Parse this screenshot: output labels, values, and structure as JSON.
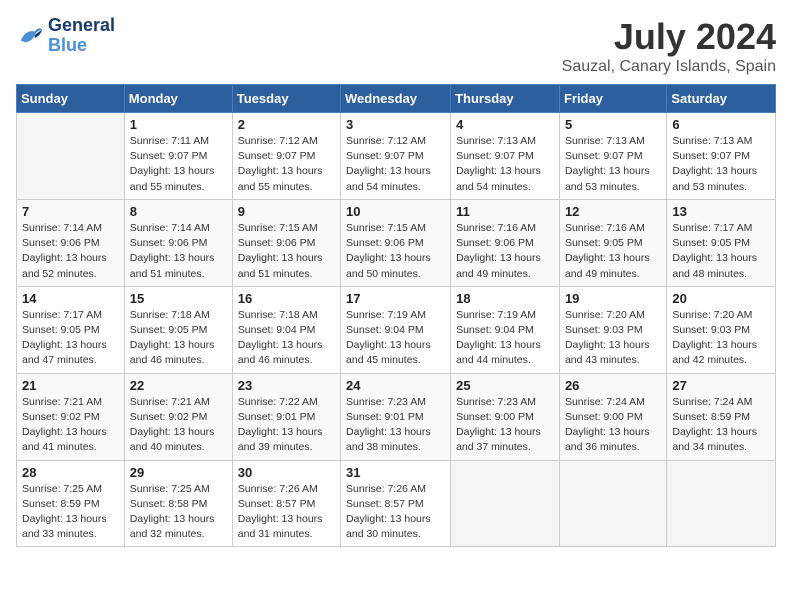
{
  "header": {
    "logo_line1": "General",
    "logo_line2": "Blue",
    "month_year": "July 2024",
    "location": "Sauzal, Canary Islands, Spain"
  },
  "columns": [
    "Sunday",
    "Monday",
    "Tuesday",
    "Wednesday",
    "Thursday",
    "Friday",
    "Saturday"
  ],
  "weeks": [
    [
      {
        "day": "",
        "info": ""
      },
      {
        "day": "1",
        "info": "Sunrise: 7:11 AM\nSunset: 9:07 PM\nDaylight: 13 hours\nand 55 minutes."
      },
      {
        "day": "2",
        "info": "Sunrise: 7:12 AM\nSunset: 9:07 PM\nDaylight: 13 hours\nand 55 minutes."
      },
      {
        "day": "3",
        "info": "Sunrise: 7:12 AM\nSunset: 9:07 PM\nDaylight: 13 hours\nand 54 minutes."
      },
      {
        "day": "4",
        "info": "Sunrise: 7:13 AM\nSunset: 9:07 PM\nDaylight: 13 hours\nand 54 minutes."
      },
      {
        "day": "5",
        "info": "Sunrise: 7:13 AM\nSunset: 9:07 PM\nDaylight: 13 hours\nand 53 minutes."
      },
      {
        "day": "6",
        "info": "Sunrise: 7:13 AM\nSunset: 9:07 PM\nDaylight: 13 hours\nand 53 minutes."
      }
    ],
    [
      {
        "day": "7",
        "info": "Sunrise: 7:14 AM\nSunset: 9:06 PM\nDaylight: 13 hours\nand 52 minutes."
      },
      {
        "day": "8",
        "info": "Sunrise: 7:14 AM\nSunset: 9:06 PM\nDaylight: 13 hours\nand 51 minutes."
      },
      {
        "day": "9",
        "info": "Sunrise: 7:15 AM\nSunset: 9:06 PM\nDaylight: 13 hours\nand 51 minutes."
      },
      {
        "day": "10",
        "info": "Sunrise: 7:15 AM\nSunset: 9:06 PM\nDaylight: 13 hours\nand 50 minutes."
      },
      {
        "day": "11",
        "info": "Sunrise: 7:16 AM\nSunset: 9:06 PM\nDaylight: 13 hours\nand 49 minutes."
      },
      {
        "day": "12",
        "info": "Sunrise: 7:16 AM\nSunset: 9:05 PM\nDaylight: 13 hours\nand 49 minutes."
      },
      {
        "day": "13",
        "info": "Sunrise: 7:17 AM\nSunset: 9:05 PM\nDaylight: 13 hours\nand 48 minutes."
      }
    ],
    [
      {
        "day": "14",
        "info": "Sunrise: 7:17 AM\nSunset: 9:05 PM\nDaylight: 13 hours\nand 47 minutes."
      },
      {
        "day": "15",
        "info": "Sunrise: 7:18 AM\nSunset: 9:05 PM\nDaylight: 13 hours\nand 46 minutes."
      },
      {
        "day": "16",
        "info": "Sunrise: 7:18 AM\nSunset: 9:04 PM\nDaylight: 13 hours\nand 46 minutes."
      },
      {
        "day": "17",
        "info": "Sunrise: 7:19 AM\nSunset: 9:04 PM\nDaylight: 13 hours\nand 45 minutes."
      },
      {
        "day": "18",
        "info": "Sunrise: 7:19 AM\nSunset: 9:04 PM\nDaylight: 13 hours\nand 44 minutes."
      },
      {
        "day": "19",
        "info": "Sunrise: 7:20 AM\nSunset: 9:03 PM\nDaylight: 13 hours\nand 43 minutes."
      },
      {
        "day": "20",
        "info": "Sunrise: 7:20 AM\nSunset: 9:03 PM\nDaylight: 13 hours\nand 42 minutes."
      }
    ],
    [
      {
        "day": "21",
        "info": "Sunrise: 7:21 AM\nSunset: 9:02 PM\nDaylight: 13 hours\nand 41 minutes."
      },
      {
        "day": "22",
        "info": "Sunrise: 7:21 AM\nSunset: 9:02 PM\nDaylight: 13 hours\nand 40 minutes."
      },
      {
        "day": "23",
        "info": "Sunrise: 7:22 AM\nSunset: 9:01 PM\nDaylight: 13 hours\nand 39 minutes."
      },
      {
        "day": "24",
        "info": "Sunrise: 7:23 AM\nSunset: 9:01 PM\nDaylight: 13 hours\nand 38 minutes."
      },
      {
        "day": "25",
        "info": "Sunrise: 7:23 AM\nSunset: 9:00 PM\nDaylight: 13 hours\nand 37 minutes."
      },
      {
        "day": "26",
        "info": "Sunrise: 7:24 AM\nSunset: 9:00 PM\nDaylight: 13 hours\nand 36 minutes."
      },
      {
        "day": "27",
        "info": "Sunrise: 7:24 AM\nSunset: 8:59 PM\nDaylight: 13 hours\nand 34 minutes."
      }
    ],
    [
      {
        "day": "28",
        "info": "Sunrise: 7:25 AM\nSunset: 8:59 PM\nDaylight: 13 hours\nand 33 minutes."
      },
      {
        "day": "29",
        "info": "Sunrise: 7:25 AM\nSunset: 8:58 PM\nDaylight: 13 hours\nand 32 minutes."
      },
      {
        "day": "30",
        "info": "Sunrise: 7:26 AM\nSunset: 8:57 PM\nDaylight: 13 hours\nand 31 minutes."
      },
      {
        "day": "31",
        "info": "Sunrise: 7:26 AM\nSunset: 8:57 PM\nDaylight: 13 hours\nand 30 minutes."
      },
      {
        "day": "",
        "info": ""
      },
      {
        "day": "",
        "info": ""
      },
      {
        "day": "",
        "info": ""
      }
    ]
  ]
}
